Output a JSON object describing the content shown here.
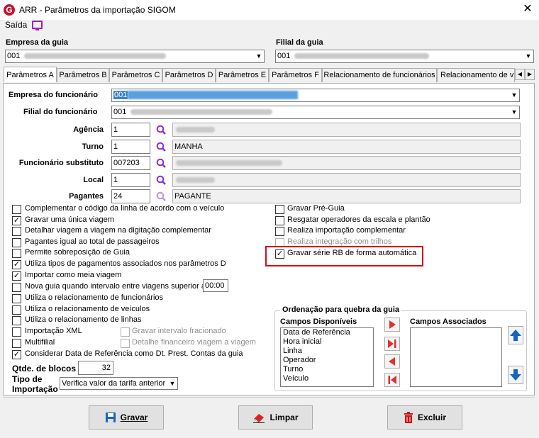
{
  "window": {
    "title": "ARR - Parâmetros da importação  SIGOM",
    "icon_letter": "G"
  },
  "menu": {
    "saida": "Saída"
  },
  "header": {
    "empresa_guia_label": "Empresa  da guia",
    "empresa_guia_value": "001",
    "filial_guia_label": "Filial  da guia",
    "filial_guia_value": "001"
  },
  "tabs": [
    {
      "label": "Parâmetros A"
    },
    {
      "label": "Parâmetros B"
    },
    {
      "label": "Parâmetros C"
    },
    {
      "label": "Parâmetros D"
    },
    {
      "label": "Parâmetros E"
    },
    {
      "label": "Parâmetros F"
    },
    {
      "label": "Relacionamento de funcionários"
    },
    {
      "label": "Relacionamento de v"
    }
  ],
  "form": {
    "empresa_func_label": "Empresa do funcionário",
    "empresa_func_value": "001",
    "filial_func_label": "Filial do funcionário",
    "filial_func_value": "001",
    "agencia_label": "Agência",
    "agencia_value": "1",
    "turno_label": "Turno",
    "turno_value": "1",
    "turno_desc": "MANHA",
    "func_subst_label": "Funcionário substituto",
    "func_subst_value": "007203",
    "local_label": "Local",
    "local_value": "1",
    "pagantes_label": "Pagantes",
    "pagantes_value": "24",
    "pagantes_desc": "PAGANTE"
  },
  "left_checks": [
    {
      "label": "Complementar o  código da linha de acordo com o veículo",
      "checked": false
    },
    {
      "label": "Gravar uma única viagem",
      "checked": true
    },
    {
      "label": "Detalhar viagem a viagem na digitação complementar",
      "checked": false
    },
    {
      "label": "Pagantes igual ao total de passageiros",
      "checked": false
    },
    {
      "label": "Permite sobreposição de Guia",
      "checked": false
    },
    {
      "label": "Utiliza tipos de pagamentos associados nos parâmetros D",
      "checked": true
    },
    {
      "label": "Importar como meia viagem",
      "checked": true
    },
    {
      "label": "Nova guia quando intervalo entre viagens superior a",
      "checked": false
    },
    {
      "label": "Utiliza o relacionamento de funcionários",
      "checked": false
    },
    {
      "label": "Utiliza o relacionamento de veículos",
      "checked": false
    },
    {
      "label": "Utiliza o relacionamento de linhas",
      "checked": false
    },
    {
      "label": "Importação XML",
      "checked": false
    },
    {
      "label": "Multifilial",
      "checked": false
    },
    {
      "label": "Considerar Data de Referência como Dt. Prest. Contas da guia",
      "checked": true
    }
  ],
  "interval_value": "00:00",
  "sub_checks": [
    {
      "label": "Gravar intervalo fracionado"
    },
    {
      "label": "Detalhe financeiro viagem a viagem"
    }
  ],
  "right_checks": [
    {
      "label": "Gravar Pré-Guia",
      "checked": false
    },
    {
      "label": "Resgatar operadores da escala e plantão",
      "checked": false
    },
    {
      "label": "Realiza importação complementar",
      "checked": false
    },
    {
      "label": "Realiza integração com trilhos",
      "checked": false
    },
    {
      "label": "Gravar série RB de forma automática",
      "checked": true
    }
  ],
  "blocos": {
    "label": "Qtde. de blocos",
    "value": "32"
  },
  "tipo_importacao": {
    "label_line1": "Tipo de",
    "label_line2": "Importação",
    "value": "Verifica valor da tarifa anterior"
  },
  "ordenacao": {
    "title": "Ordenação para quebra da guia",
    "disponiveis_label": "Campos Disponíveis",
    "associados_label": "Campos Associados",
    "disponiveis": [
      "Data de Referência",
      "Hora inicial",
      "Linha",
      "Operador",
      "Turno",
      "Veículo"
    ]
  },
  "buttons": {
    "gravar": "Gravar",
    "limpar": "Limpar",
    "excluir": "Excluir"
  },
  "colors": {
    "accent_red": "#c8102e",
    "highlight": "#d01010",
    "purple": "#8a2be2",
    "blue": "#1565c0"
  }
}
